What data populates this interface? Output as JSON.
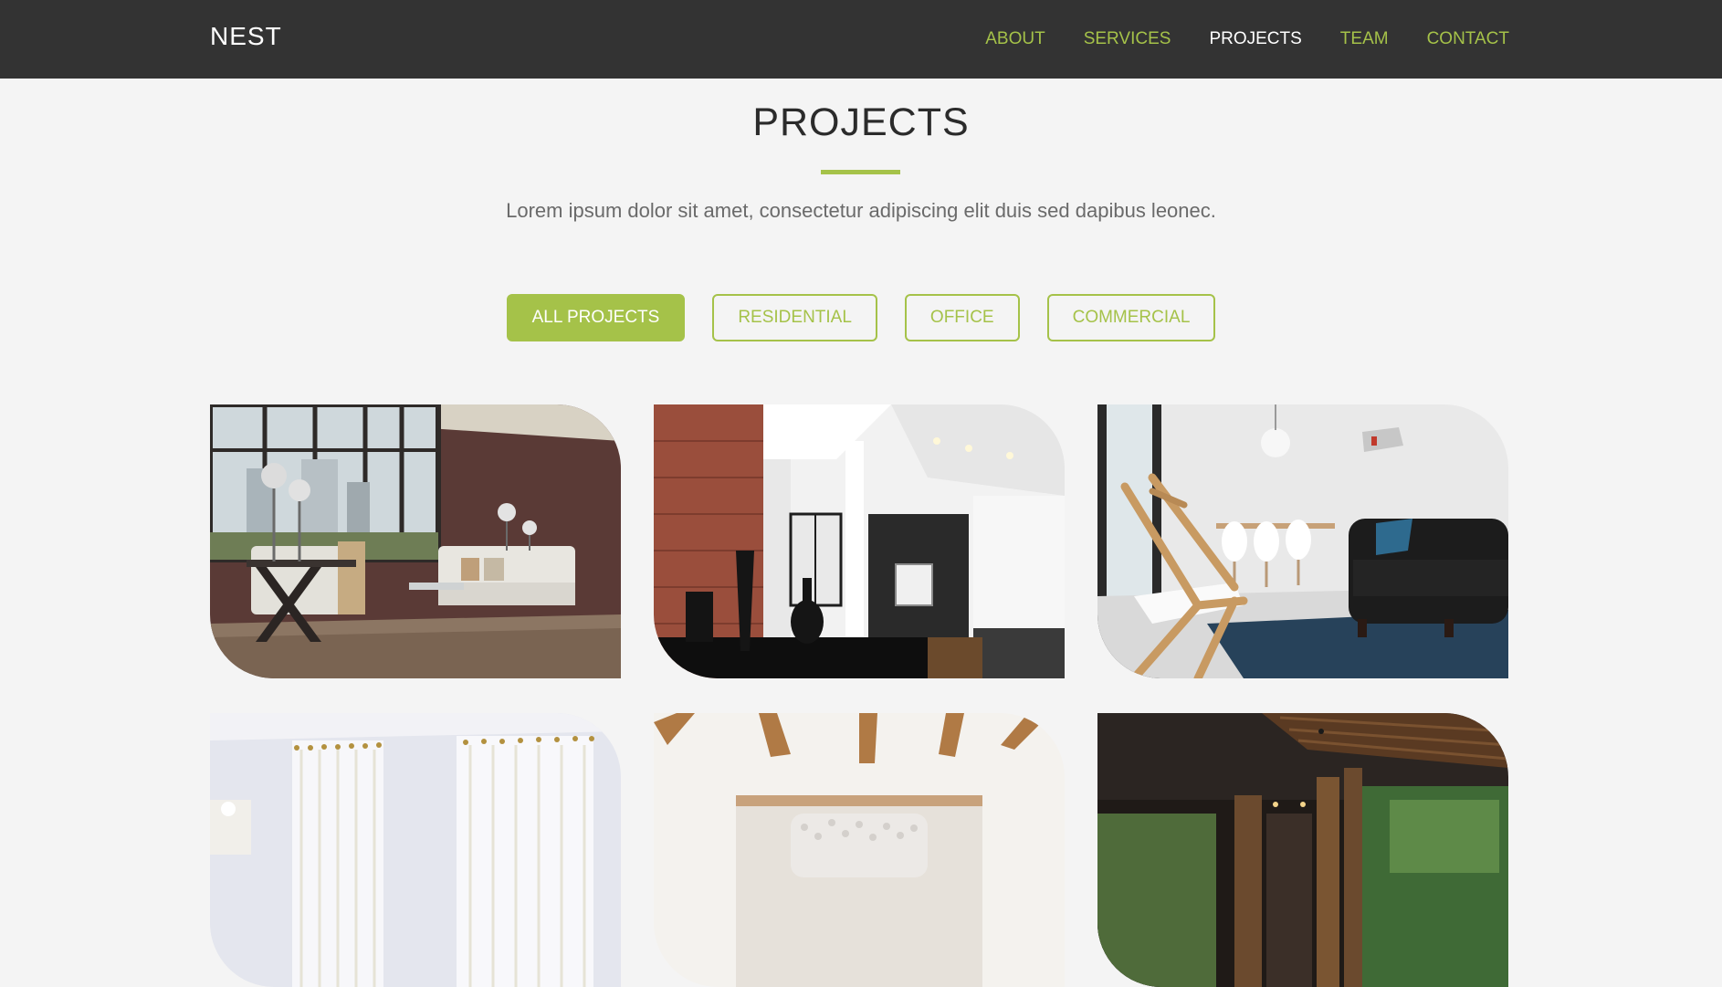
{
  "header": {
    "brand": "NEST",
    "nav": [
      {
        "label": "ABOUT",
        "active": false
      },
      {
        "label": "SERVICES",
        "active": false
      },
      {
        "label": "PROJECTS",
        "active": true
      },
      {
        "label": "TEAM",
        "active": false
      },
      {
        "label": "CONTACT",
        "active": false
      }
    ]
  },
  "projects": {
    "title": "PROJECTS",
    "subtitle": "Lorem ipsum dolor sit amet, consectetur adipiscing elit duis sed dapibus leonec.",
    "filters": [
      {
        "label": "ALL PROJECTS",
        "active": true
      },
      {
        "label": "RESIDENTIAL",
        "active": false
      },
      {
        "label": "OFFICE",
        "active": false
      },
      {
        "label": "COMMERCIAL",
        "active": false
      }
    ]
  },
  "colors": {
    "accent": "#a5c249",
    "navbar": "#333333",
    "background": "#f4f4f4"
  }
}
